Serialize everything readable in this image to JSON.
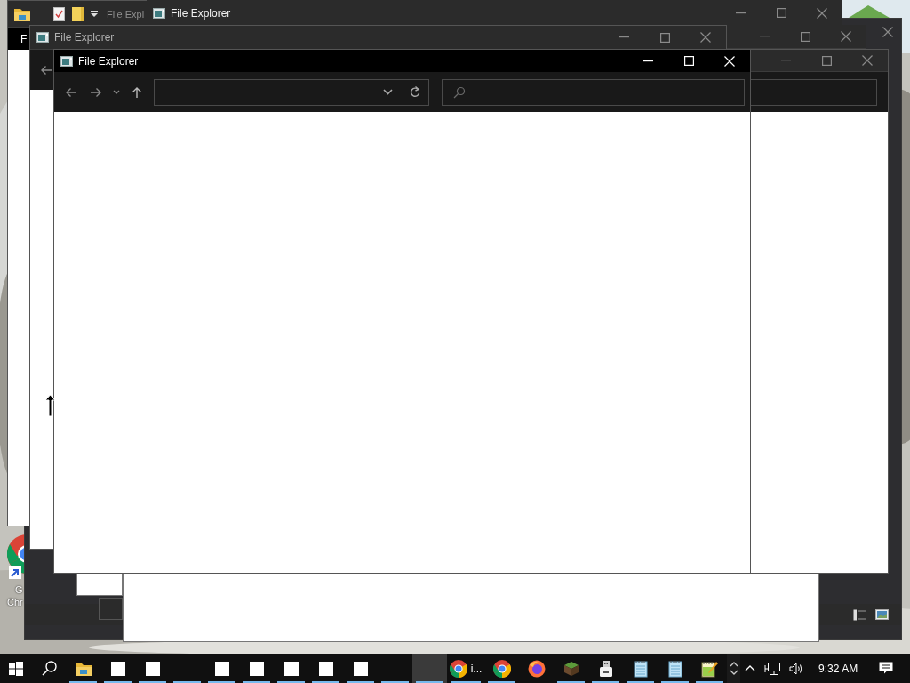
{
  "desktop": {
    "kind": "picture",
    "shortcut": {
      "label_lines": [
        "G",
        "Chr"
      ]
    }
  },
  "windows": [
    {
      "kind": "dark",
      "active": false
    },
    {
      "kind": "blank"
    },
    {
      "kind": "blank"
    },
    {
      "kind": "fragment"
    },
    {
      "kind": "explorer-ribbon",
      "title": "File Expl",
      "ribbon_tab": "F",
      "active": false
    },
    {
      "kind": "titlebar",
      "title": "File Explorer",
      "active": false
    },
    {
      "kind": "explorer-partial",
      "title": "File Explorer",
      "active": false
    },
    {
      "kind": "titlebar",
      "active": false
    },
    {
      "kind": "explorer-side",
      "active": false
    },
    {
      "kind": "explorer",
      "title": "File Explorer",
      "active": true
    }
  ],
  "taskbar": {
    "items": [
      {
        "kind": "start"
      },
      {
        "kind": "search"
      },
      {
        "kind": "folder",
        "running": true,
        "active": false
      },
      {
        "kind": "blank",
        "running": true,
        "active": false
      },
      {
        "kind": "blank",
        "running": true,
        "active": false
      },
      {
        "kind": "empty",
        "running": true,
        "active": false
      },
      {
        "kind": "blank",
        "running": true,
        "active": false
      },
      {
        "kind": "blank",
        "running": true,
        "active": false
      },
      {
        "kind": "blank",
        "running": true,
        "active": false
      },
      {
        "kind": "blank",
        "running": true,
        "active": false
      },
      {
        "kind": "blank",
        "running": true,
        "active": false
      },
      {
        "kind": "empty",
        "running": true,
        "active": false
      },
      {
        "kind": "empty",
        "running": true,
        "active": true
      },
      {
        "kind": "chrome",
        "label": "i...",
        "running": true,
        "active": false
      },
      {
        "kind": "chrome",
        "running": true,
        "active": false
      },
      {
        "kind": "firefox",
        "running": false,
        "active": false
      },
      {
        "kind": "block",
        "running": true,
        "active": false
      },
      {
        "kind": "usb",
        "running": true,
        "active": false
      },
      {
        "kind": "notepad",
        "running": true,
        "active": false
      },
      {
        "kind": "notepad",
        "running": true,
        "active": false
      },
      {
        "kind": "editor",
        "running": true,
        "active": false
      }
    ],
    "clock": "9:32 AM"
  }
}
